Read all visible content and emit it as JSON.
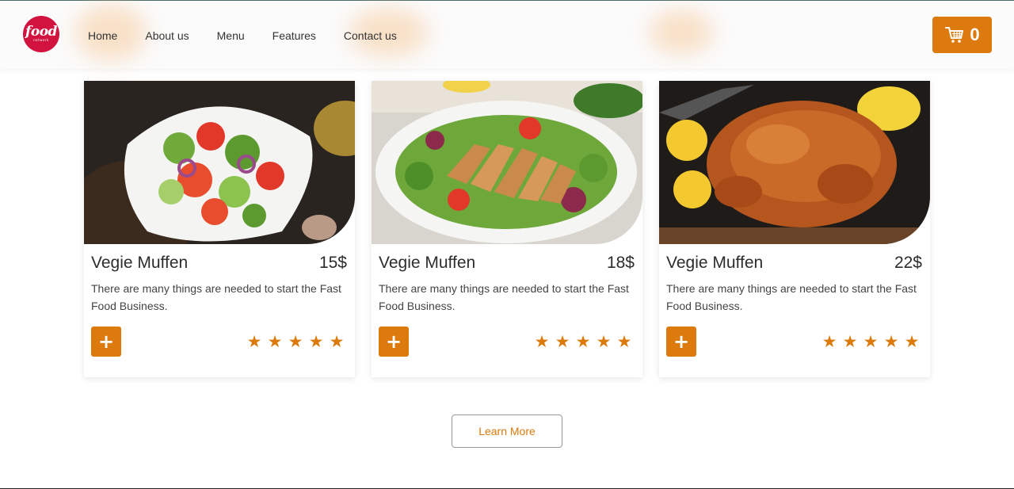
{
  "brand": {
    "logo_word": "food",
    "logo_sub": "network"
  },
  "nav": {
    "items": [
      {
        "label": "Home"
      },
      {
        "label": "About us"
      },
      {
        "label": "Menu"
      },
      {
        "label": "Features"
      },
      {
        "label": "Contact us"
      }
    ]
  },
  "cart": {
    "icon": "cart-icon",
    "count": "0"
  },
  "products": [
    {
      "title": "Vegie Muffen",
      "price": "15$",
      "description": "There are many things are needed to start the Fast Food Business.",
      "add_label": "+",
      "rating": 5,
      "image": "salad-bowl-photo"
    },
    {
      "title": "Vegie Muffen",
      "price": "18$",
      "description": "There are many things are needed to start the Fast Food Business.",
      "add_label": "+",
      "rating": 5,
      "image": "chicken-salad-photo"
    },
    {
      "title": "Vegie Muffen",
      "price": "22$",
      "description": "There are many things are needed to start the Fast Food Business.",
      "add_label": "+",
      "rating": 5,
      "image": "roast-chicken-photo"
    }
  ],
  "learn_more": {
    "label": "Learn More"
  },
  "colors": {
    "accent": "#dd7a0d",
    "logo": "#d2123f"
  }
}
